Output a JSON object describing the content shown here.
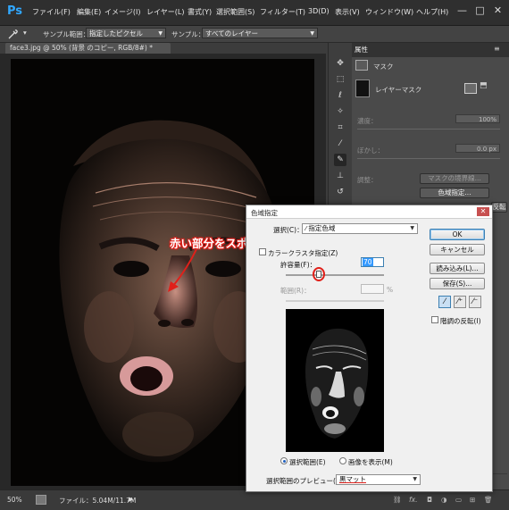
{
  "app": {
    "logo": "Ps"
  },
  "menu": [
    "ファイル(F)",
    "編集(E)",
    "イメージ(I)",
    "レイヤー(L)",
    "書式(Y)",
    "選択範囲(S)",
    "フィルター(T)",
    "3D(D)",
    "表示(V)",
    "ウィンドウ(W)",
    "ヘルプ(H)"
  ],
  "window_controls": [
    "—",
    "□",
    "✕"
  ],
  "options_bar": {
    "tool_icon": "eyedropper-icon",
    "sample_size_label": "サンプル範囲：",
    "sample_size_value": "指定したピクセル",
    "sample_label": "サンプル：",
    "sample_value": "すべてのレイヤー"
  },
  "document": {
    "tab_title": "face3.jpg @ 50% (背景 のコピー, RGB/8#) *"
  },
  "properties_panel": {
    "tab": "属性",
    "section_title": "マスク",
    "layer_mask_label": "レイヤーマスク",
    "density_label": "濃度：",
    "density_value": "100%",
    "feather_label": "ぼかし：",
    "feather_value": "0.0 px",
    "adjust_label": "調整：",
    "mask_edge_button": "マスクの境界線...",
    "color_range_button": "色域指定...",
    "invert_button": "反転"
  },
  "status_bar": {
    "zoom": "50%",
    "file_info": "ファイル：5.04M/11.7M"
  },
  "dialog": {
    "title": "色域指定",
    "select_label": "選択(C)：",
    "select_value": "指定色域",
    "localized_clusters": "カラークラスタ指定(Z)",
    "fuzziness_label": "許容量(F)：",
    "fuzziness_value": "70",
    "range_label": "範囲(R)：",
    "range_unit": "%",
    "ok": "OK",
    "cancel": "キャンセル",
    "load": "読み込み(L)...",
    "save": "保存(S)...",
    "invert": "階調の反転(I)",
    "radio_selection": "選択範囲(E)",
    "radio_image": "画像を表示(M)",
    "preview_label": "選択範囲のプレビュー(T)：",
    "preview_value": "黒マット",
    "fuzziness_slider_fraction": 0.34
  },
  "annotation": {
    "text": "赤い部分をスポイトで抽出"
  },
  "colors": {
    "annotation_red": "#e0201a",
    "accent_blue": "#31a8ff"
  }
}
